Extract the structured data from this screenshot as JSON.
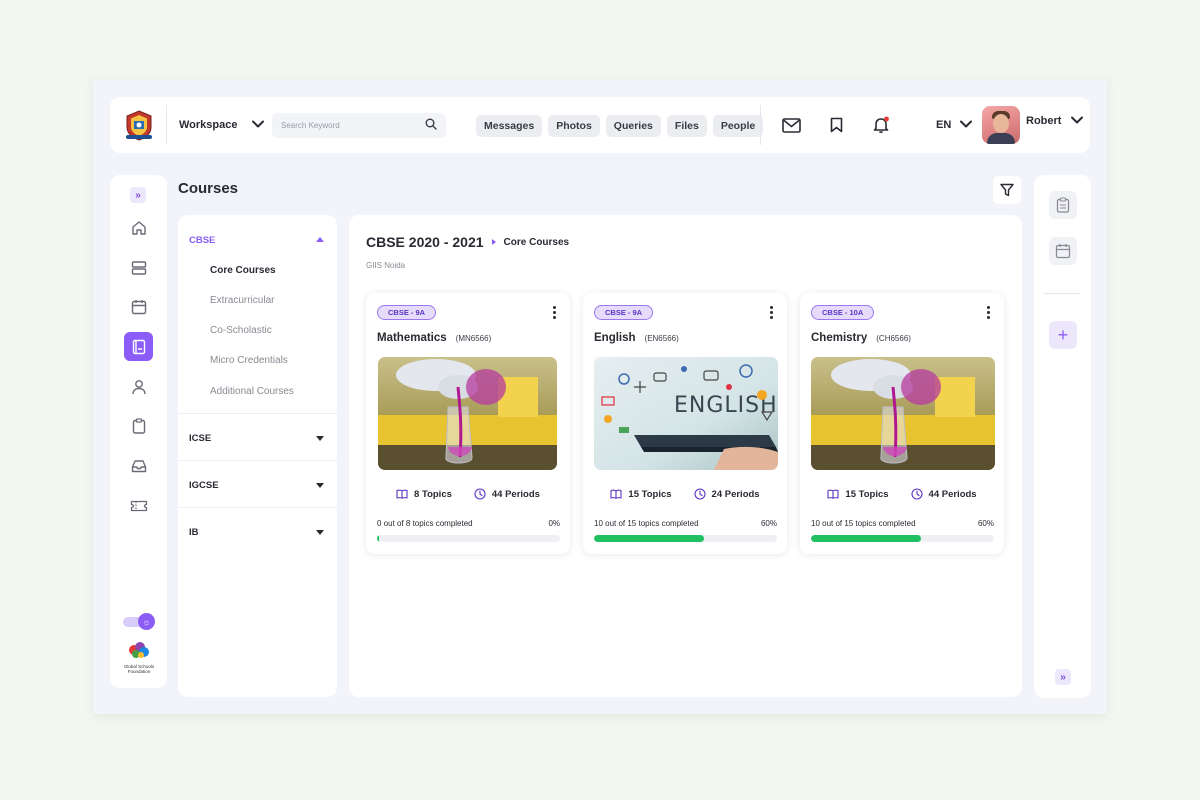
{
  "topbar": {
    "workspace_label": "Workspace",
    "search_placeholder": "Search Keyword",
    "chips": [
      "Messages",
      "Photos",
      "Queries",
      "Files",
      "People"
    ],
    "language": "EN",
    "user_name": "Robert"
  },
  "page": {
    "title": "Courses"
  },
  "curriculum": {
    "sections": [
      {
        "label": "CBSE",
        "expanded": true,
        "items": [
          "Core Courses",
          "Extracurricular",
          "Co-Scholastic",
          "Micro Credentials",
          "Additional Courses"
        ]
      },
      {
        "label": "ICSE",
        "expanded": false
      },
      {
        "label": "IGCSE",
        "expanded": false
      },
      {
        "label": "IB",
        "expanded": false
      }
    ],
    "active_item": "Core Courses"
  },
  "main": {
    "year_title": "CBSE 2020 - 2021",
    "breadcrumb_sub": "Core Courses",
    "school": "GIIS Noida"
  },
  "courses": [
    {
      "badge": "CBSE - 9A",
      "name": "Mathematics",
      "code": "(MN6566)",
      "image": "chemistry-lab-photo",
      "topics": "8 Topics",
      "periods": "44 Periods",
      "progress_text": "0 out of 8 topics completed",
      "percent_text": "0%",
      "progress": 0.01
    },
    {
      "badge": "CBSE - 9A",
      "name": "English",
      "code": "(EN6566)",
      "image": "english-tablet-photo",
      "topics": "15 Topics",
      "periods": "24 Periods",
      "progress_text": "10 out of 15 topics completed",
      "percent_text": "60%",
      "progress": 0.6
    },
    {
      "badge": "CBSE - 10A",
      "name": "Chemistry",
      "code": "(CH6566)",
      "image": "chemistry-lab-photo",
      "topics": "15 Topics",
      "periods": "44 Periods",
      "progress_text": "10 out of 15 topics completed",
      "percent_text": "60%",
      "progress": 0.6
    }
  ],
  "colors": {
    "accent": "#8b5cf6",
    "progress": "#21c063",
    "badge_bg": "#e5dcfb",
    "notification": "#e53935"
  },
  "icons": {
    "left_rail": [
      "home-icon",
      "layers-icon",
      "calendar-icon",
      "notebook-icon",
      "user-icon",
      "clipboard-icon",
      "inbox-icon",
      "ticket-icon"
    ],
    "right_rail": [
      "clipboard-icon",
      "calendar-icon",
      "plus-icon"
    ]
  },
  "brand": {
    "foundation_logo_text": "Global Schools Foundation"
  }
}
